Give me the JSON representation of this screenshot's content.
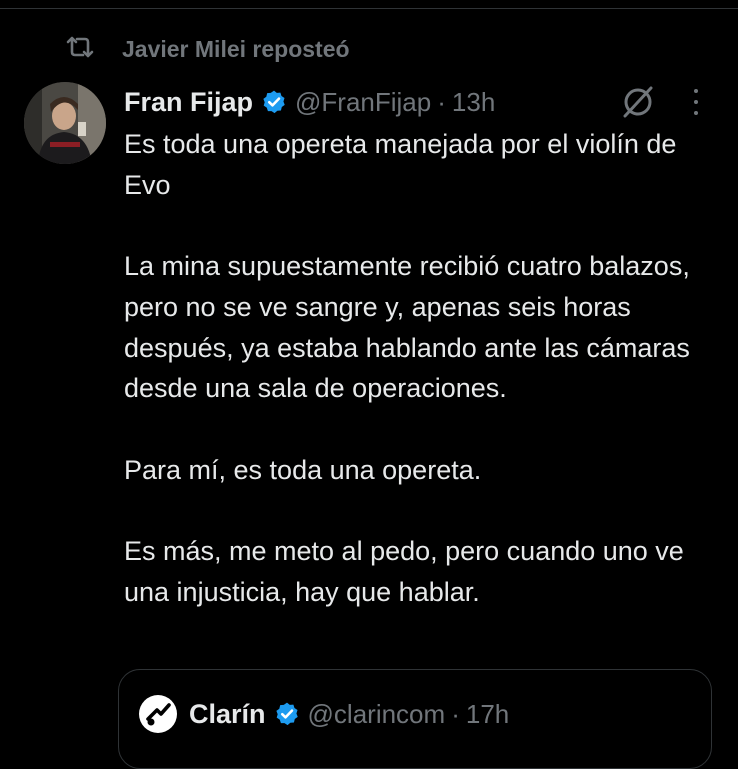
{
  "repost": {
    "label": "Javier Milei reposteó",
    "icon": "repost-icon"
  },
  "tweet": {
    "author_name": "Fran Fijap",
    "handle": "@FranFijap",
    "separator": "·",
    "time": "13h",
    "verified_color": "#1d9bf0",
    "paragraphs": [
      "Es toda una opereta manejada por el violín de Evo",
      "La mina supuestamente recibió cuatro balazos, pero no se ve sangre y, apenas seis horas después, ya estaba hablando ante las cámaras desde una sala de operaciones.",
      "Para mí, es toda una opereta.",
      "Es más, me meto al pedo, pero cuando uno ve una injusticia, hay que hablar."
    ]
  },
  "quote": {
    "author_name": "Clarín",
    "handle": "@clarincom",
    "separator": "·",
    "time": "17h"
  },
  "colors": {
    "background": "#000000",
    "text": "#e7e9ea",
    "muted": "#71767b",
    "border": "#2f3336",
    "verified": "#1d9bf0"
  }
}
